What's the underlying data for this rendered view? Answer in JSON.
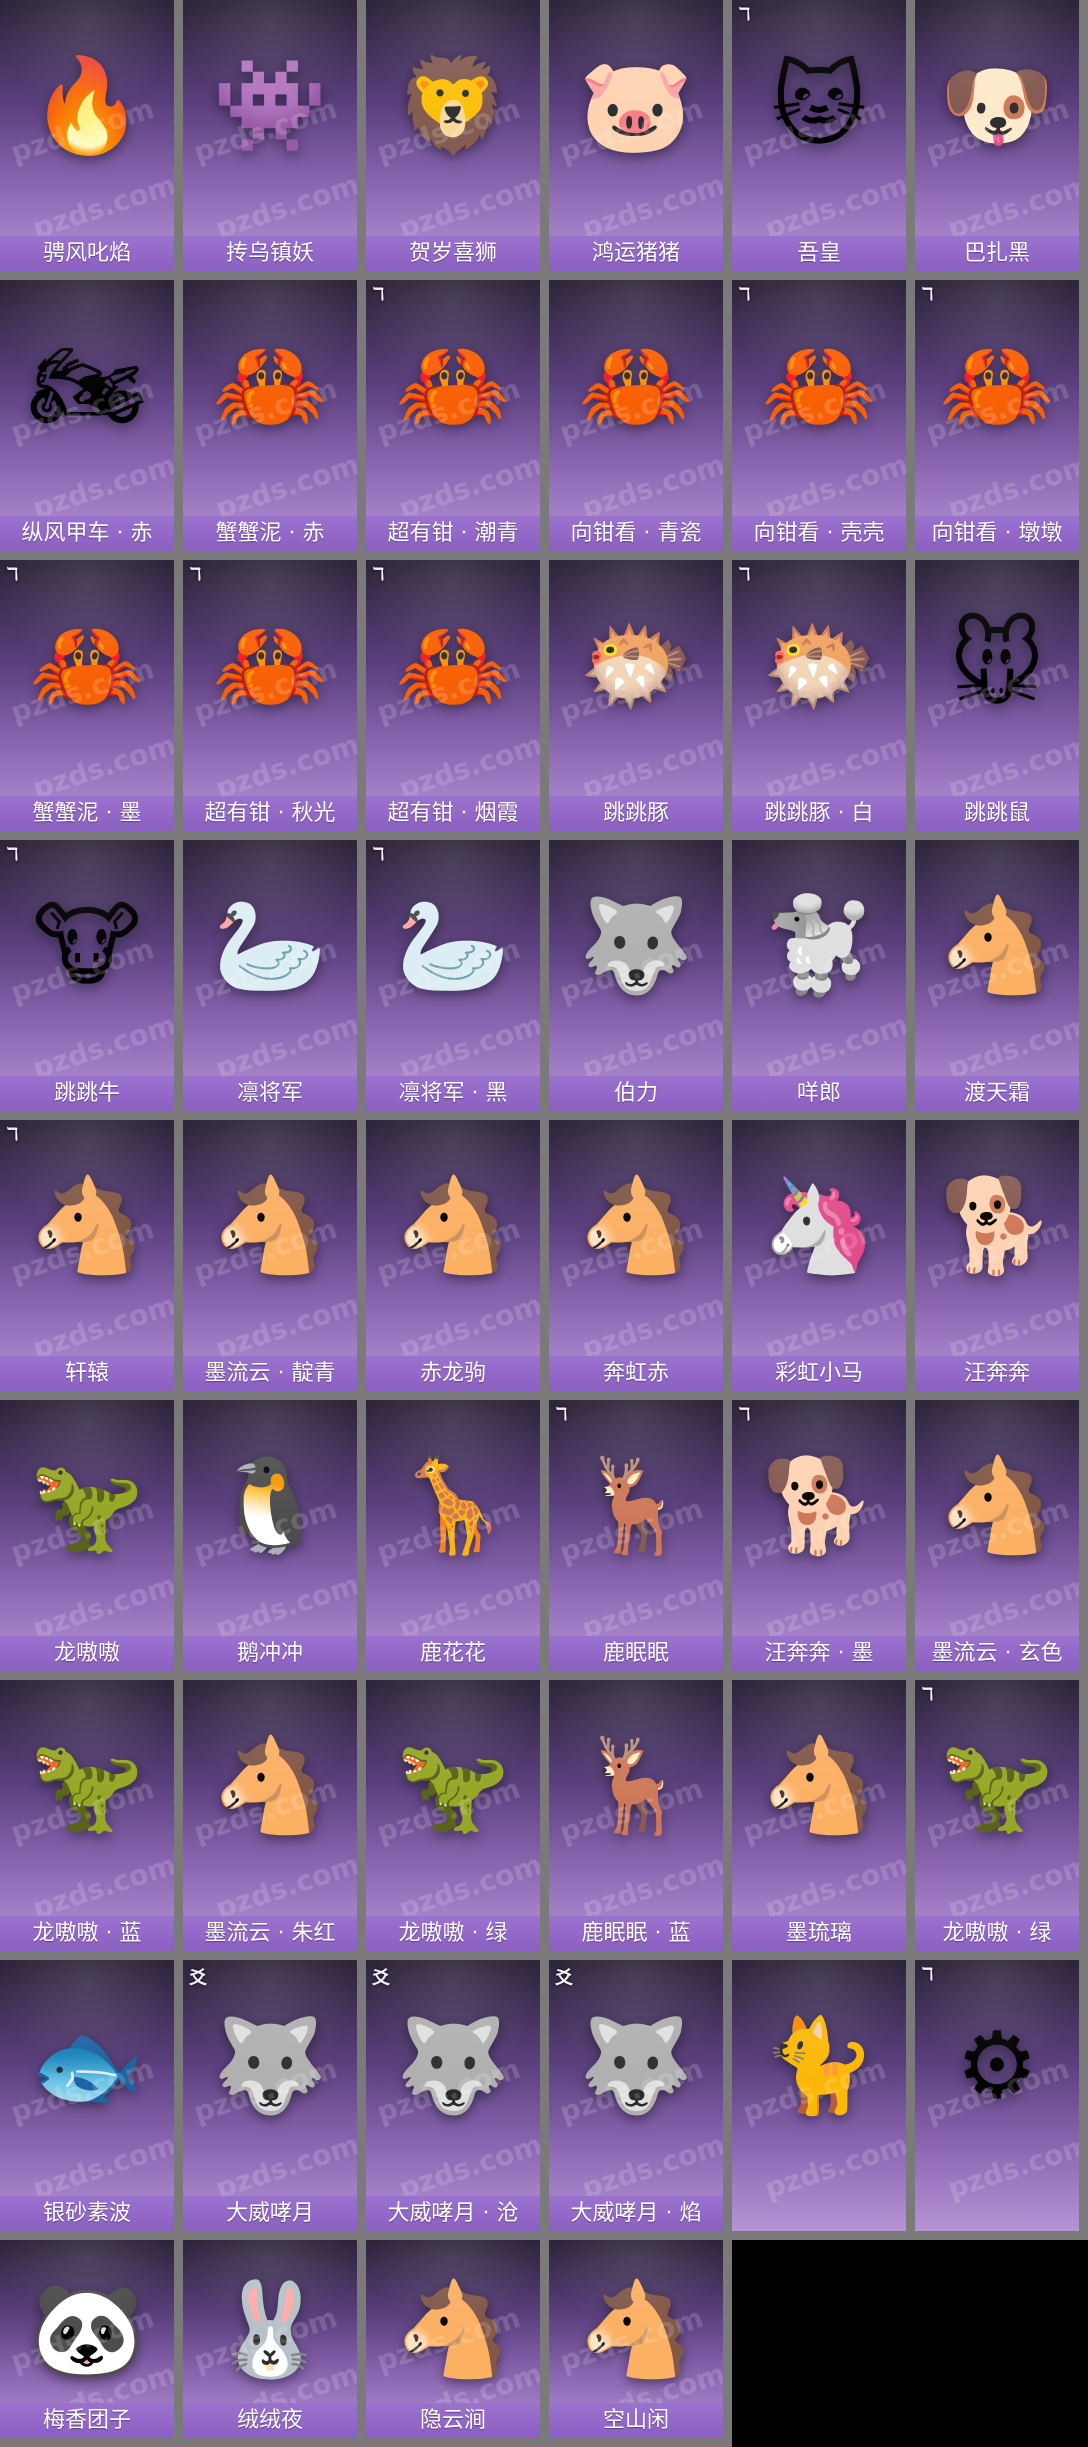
{
  "watermark": "pzds.com",
  "items": [
    {
      "name": "骋风叱焰",
      "icon": "fire-rider-icon",
      "glyph": "🔥",
      "badge": ""
    },
    {
      "name": "抟乌镇妖",
      "icon": "purple-spirit-icon",
      "glyph": "👾",
      "badge": ""
    },
    {
      "name": "贺岁喜狮",
      "icon": "lion-icon",
      "glyph": "🦁",
      "badge": ""
    },
    {
      "name": "鸿运猪猪",
      "icon": "pig-icon",
      "glyph": "🐷",
      "badge": ""
    },
    {
      "name": "吾皇",
      "icon": "cat-icon",
      "glyph": "🐱",
      "badge": "ℸ"
    },
    {
      "name": "巴扎黑",
      "icon": "pug-icon",
      "glyph": "🐶",
      "badge": ""
    },
    {
      "name": "纵风甲车 · 赤",
      "icon": "motorbike-icon",
      "glyph": "🏍",
      "badge": ""
    },
    {
      "name": "蟹蟹泥 · 赤",
      "icon": "crab-icon",
      "glyph": "🦀",
      "badge": ""
    },
    {
      "name": "超有钳 · 潮青",
      "icon": "crab-icon",
      "glyph": "🦀",
      "badge": "ℸ"
    },
    {
      "name": "向钳看 · 青瓷",
      "icon": "crab-icon",
      "glyph": "🦀",
      "badge": ""
    },
    {
      "name": "向钳看 · 壳壳",
      "icon": "crab-icon",
      "glyph": "🦀",
      "badge": "ℸ"
    },
    {
      "name": "向钳看 · 墩墩",
      "icon": "crab-icon",
      "glyph": "🦀",
      "badge": "ℸ"
    },
    {
      "name": "蟹蟹泥 · 墨",
      "icon": "crab-icon",
      "glyph": "🦀",
      "badge": "ℸ"
    },
    {
      "name": "超有钳 · 秋光",
      "icon": "crab-icon",
      "glyph": "🦀",
      "badge": "ℸ"
    },
    {
      "name": "超有钳 · 烟霞",
      "icon": "crab-icon",
      "glyph": "🦀",
      "badge": "ℸ"
    },
    {
      "name": "跳跳豚",
      "icon": "pufferfish-icon",
      "glyph": "🐡",
      "badge": ""
    },
    {
      "name": "跳跳豚 · 白",
      "icon": "pufferfish-icon",
      "glyph": "🐡",
      "badge": "ℸ"
    },
    {
      "name": "跳跳鼠",
      "icon": "mouse-icon",
      "glyph": "🐭",
      "badge": ""
    },
    {
      "name": "跳跳牛",
      "icon": "cow-icon",
      "glyph": "🐮",
      "badge": "ℸ"
    },
    {
      "name": "凛将军",
      "icon": "goose-icon",
      "glyph": "🦢",
      "badge": ""
    },
    {
      "name": "凛将军 · 黑",
      "icon": "goose-icon",
      "glyph": "🦢",
      "badge": "ℸ"
    },
    {
      "name": "伯力",
      "icon": "husky-icon",
      "glyph": "🐺",
      "badge": ""
    },
    {
      "name": "咩郎",
      "icon": "white-dog-icon",
      "glyph": "🐩",
      "badge": ""
    },
    {
      "name": "渡天霜",
      "icon": "horse-icon",
      "glyph": "🐴",
      "badge": ""
    },
    {
      "name": "轩辕",
      "icon": "horse-icon",
      "glyph": "🐴",
      "badge": "ℸ"
    },
    {
      "name": "墨流云 · 靛青",
      "icon": "horse-icon",
      "glyph": "🐴",
      "badge": ""
    },
    {
      "name": "赤龙驹",
      "icon": "horse-icon",
      "glyph": "🐴",
      "badge": ""
    },
    {
      "name": "奔虹赤",
      "icon": "horse-icon",
      "glyph": "🐴",
      "badge": ""
    },
    {
      "name": "彩虹小马",
      "icon": "rainbow-pony-icon",
      "glyph": "🦄",
      "badge": ""
    },
    {
      "name": "汪奔奔",
      "icon": "corgi-icon",
      "glyph": "🐕",
      "badge": ""
    },
    {
      "name": "龙嗷嗷",
      "icon": "dinosaur-icon",
      "glyph": "🦖",
      "badge": ""
    },
    {
      "name": "鹅冲冲",
      "icon": "penguin-icon",
      "glyph": "🐧",
      "badge": ""
    },
    {
      "name": "鹿花花",
      "icon": "giraffe-icon",
      "glyph": "🦒",
      "badge": ""
    },
    {
      "name": "鹿眠眠",
      "icon": "deer-icon",
      "glyph": "🦌",
      "badge": "ℸ"
    },
    {
      "name": "汪奔奔 · 墨",
      "icon": "corgi-icon",
      "glyph": "🐕",
      "badge": "ℸ"
    },
    {
      "name": "墨流云 · 玄色",
      "icon": "horse-icon",
      "glyph": "🐴",
      "badge": ""
    },
    {
      "name": "龙嗷嗷 · 蓝",
      "icon": "dinosaur-icon",
      "glyph": "🦖",
      "badge": ""
    },
    {
      "name": "墨流云 · 朱红",
      "icon": "horse-icon",
      "glyph": "🐴",
      "badge": ""
    },
    {
      "name": "龙嗷嗷 · 绿",
      "icon": "dinosaur-icon",
      "glyph": "🦖",
      "badge": ""
    },
    {
      "name": "鹿眠眠 · 蓝",
      "icon": "deer-icon",
      "glyph": "🦌",
      "badge": ""
    },
    {
      "name": "墨琉璃",
      "icon": "horse-icon",
      "glyph": "🐴",
      "badge": ""
    },
    {
      "name": "龙嗷嗷 · 绿",
      "icon": "dinosaur-icon",
      "glyph": "🦖",
      "badge": "ℸ"
    },
    {
      "name": "银砂素波",
      "icon": "fish-icon",
      "glyph": "🐟",
      "badge": ""
    },
    {
      "name": "大威哮月",
      "icon": "wolf-icon",
      "glyph": "🐺",
      "badge": "爻"
    },
    {
      "name": "大威哮月 · 沧",
      "icon": "wolf-icon",
      "glyph": "🐺",
      "badge": "爻"
    },
    {
      "name": "大威哮月 · 焰",
      "icon": "wolf-icon",
      "glyph": "🐺",
      "badge": "爻"
    },
    {
      "name": "",
      "icon": "white-cat-icon",
      "glyph": "🐈",
      "badge": ""
    },
    {
      "name": "",
      "icon": "mech-walker-icon",
      "glyph": "⚙",
      "badge": "ℸ"
    },
    {
      "name": "梅香团子",
      "icon": "panda-icon",
      "glyph": "🐼",
      "badge": ""
    },
    {
      "name": "绒绒夜",
      "icon": "rabbit-icon",
      "glyph": "🐰",
      "badge": ""
    },
    {
      "name": "隐云涧",
      "icon": "donkey-icon",
      "glyph": "🐴",
      "badge": ""
    },
    {
      "name": "空山闲",
      "icon": "donkey-icon",
      "glyph": "🐴",
      "badge": ""
    }
  ]
}
